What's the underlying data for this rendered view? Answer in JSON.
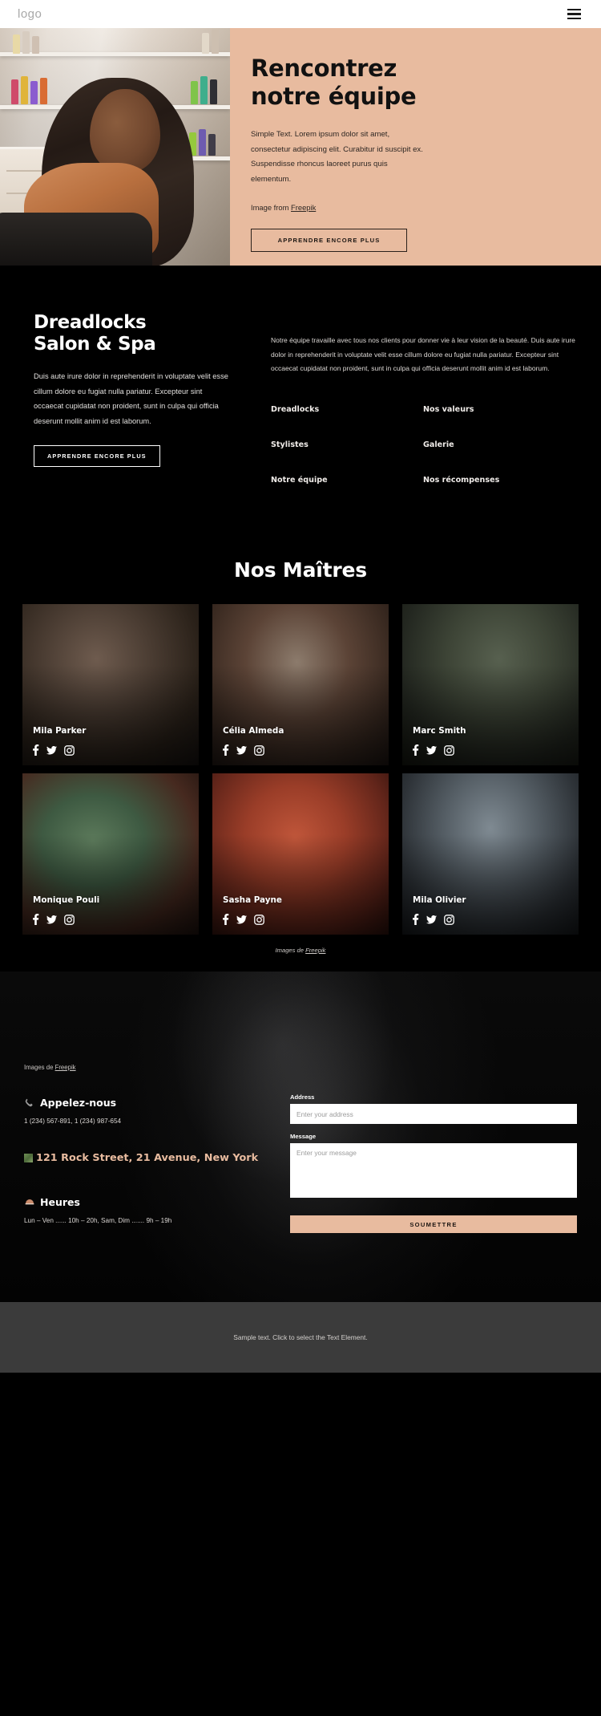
{
  "header": {
    "logo": "logo",
    "menu_icon": "hamburger-menu-icon"
  },
  "hero": {
    "title_line1": "Rencontrez",
    "title_line2": "notre équipe",
    "description": "Simple Text. Lorem ipsum dolor sit amet, consectetur adipiscing elit. Curabitur id suscipit ex. Suspendisse rhoncus laoreet purus quis elementum.",
    "credit_prefix": "Image from ",
    "credit_link": "Freepik",
    "button": "APPRENDRE ENCORE PLUS",
    "panel_color": "#e8bb9f"
  },
  "about": {
    "title_line1": "Dreadlocks",
    "title_line2": "Salon & Spa",
    "text": "Duis aute irure dolor in reprehenderit in voluptate velit esse cillum dolore eu fugiat nulla pariatur. Excepteur sint occaecat cupidatat non proident, sunt in culpa qui officia deserunt mollit anim id est laborum.",
    "button": "APPRENDRE ENCORE PLUS",
    "paragraph": "Notre équipe travaille avec tous nos clients pour donner vie à leur vision de la beauté. Duis aute irure dolor in reprehenderit in voluptate velit esse cillum dolore eu fugiat nulla pariatur. Excepteur sint occaecat cupidatat non proident, sunt in culpa qui officia deserunt mollit anim id est laborum.",
    "links": [
      "Dreadlocks",
      "Nos valeurs",
      "Stylistes",
      "Galerie",
      "Notre équipe",
      "Nos récompenses"
    ]
  },
  "team": {
    "title": "Nos Maîtres",
    "members": [
      {
        "name": "Mila Parker",
        "socials": [
          "facebook-icon",
          "twitter-icon",
          "instagram-icon"
        ]
      },
      {
        "name": "Célia Almeda",
        "socials": [
          "facebook-icon",
          "twitter-icon",
          "instagram-icon"
        ]
      },
      {
        "name": "Marc Smith",
        "socials": [
          "facebook-icon",
          "twitter-icon",
          "instagram-icon"
        ]
      },
      {
        "name": "Monique Pouli",
        "socials": [
          "facebook-icon",
          "twitter-icon",
          "instagram-icon"
        ]
      },
      {
        "name": "Sasha Payne",
        "socials": [
          "facebook-icon",
          "twitter-icon",
          "instagram-icon"
        ]
      },
      {
        "name": "Mila Olivier",
        "socials": [
          "facebook-icon",
          "twitter-icon",
          "instagram-icon"
        ]
      }
    ],
    "credit_prefix": "Images de ",
    "credit_link": "Freepik"
  },
  "contact": {
    "credit_prefix": "Images de ",
    "credit_link": "Freepik",
    "call_title": "Appelez-nous",
    "phones": "1 (234) 567-891, 1 (234) 987-654",
    "address": "121 Rock Street, 21 Avenue, New York",
    "hours_title": "Heures",
    "hours": "Lun – Ven ...... 10h – 20h, Sam, Dim ....... 9h – 19h",
    "form": {
      "address_label": "Address",
      "address_placeholder": "Enter your address",
      "address_value": "",
      "message_label": "Message",
      "message_placeholder": "Enter your message",
      "message_value": "",
      "submit": "SOUMETTRE",
      "submit_color": "#e8bb9f"
    }
  },
  "footer": {
    "text": "Sample text. Click to select the Text Element.",
    "background": "#3b3b3b"
  }
}
